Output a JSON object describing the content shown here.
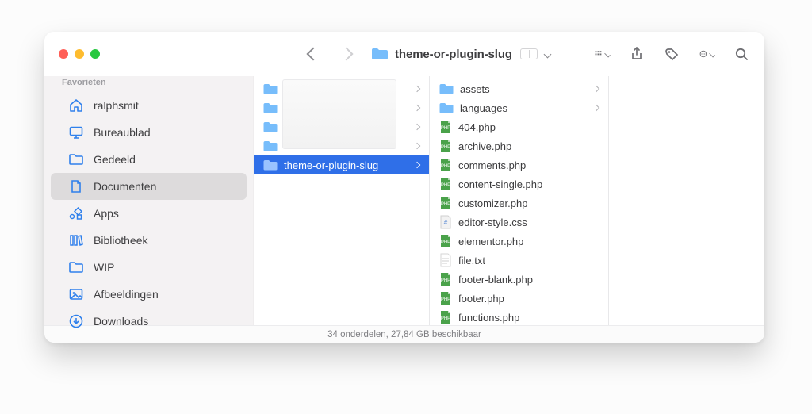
{
  "sidebar": {
    "header": "Favorieten",
    "items": [
      {
        "icon": "home",
        "label": "ralphsmit"
      },
      {
        "icon": "desktop",
        "label": "Bureaublad"
      },
      {
        "icon": "folder",
        "label": "Gedeeld"
      },
      {
        "icon": "doc",
        "label": "Documenten"
      },
      {
        "icon": "apps",
        "label": "Apps"
      },
      {
        "icon": "library",
        "label": "Bibliotheek"
      },
      {
        "icon": "folder",
        "label": "WIP"
      },
      {
        "icon": "image",
        "label": "Afbeeldingen"
      },
      {
        "icon": "download",
        "label": "Downloads"
      }
    ],
    "activeIndex": 3
  },
  "toolbar": {
    "title": "theme-or-plugin-slug"
  },
  "col1": {
    "items": [
      {
        "type": "folder",
        "label": ""
      },
      {
        "type": "folder",
        "label": ""
      },
      {
        "type": "folder",
        "label": ""
      },
      {
        "type": "folder",
        "label": ""
      },
      {
        "type": "folder",
        "label": "theme-or-plugin-slug",
        "selected": true
      }
    ]
  },
  "col2": {
    "items": [
      {
        "type": "folder",
        "label": "assets",
        "hasChildren": true
      },
      {
        "type": "folder",
        "label": "languages",
        "hasChildren": true
      },
      {
        "type": "php",
        "label": "404.php"
      },
      {
        "type": "php",
        "label": "archive.php"
      },
      {
        "type": "php",
        "label": "comments.php"
      },
      {
        "type": "php",
        "label": "content-single.php"
      },
      {
        "type": "php",
        "label": "customizer.php"
      },
      {
        "type": "css",
        "label": "editor-style.css"
      },
      {
        "type": "php",
        "label": "elementor.php"
      },
      {
        "type": "txt",
        "label": "file.txt"
      },
      {
        "type": "php",
        "label": "footer-blank.php"
      },
      {
        "type": "php",
        "label": "footer.php"
      },
      {
        "type": "php",
        "label": "functions.php"
      }
    ]
  },
  "footer": {
    "status": "34 onderdelen, 27,84 GB beschikbaar"
  }
}
